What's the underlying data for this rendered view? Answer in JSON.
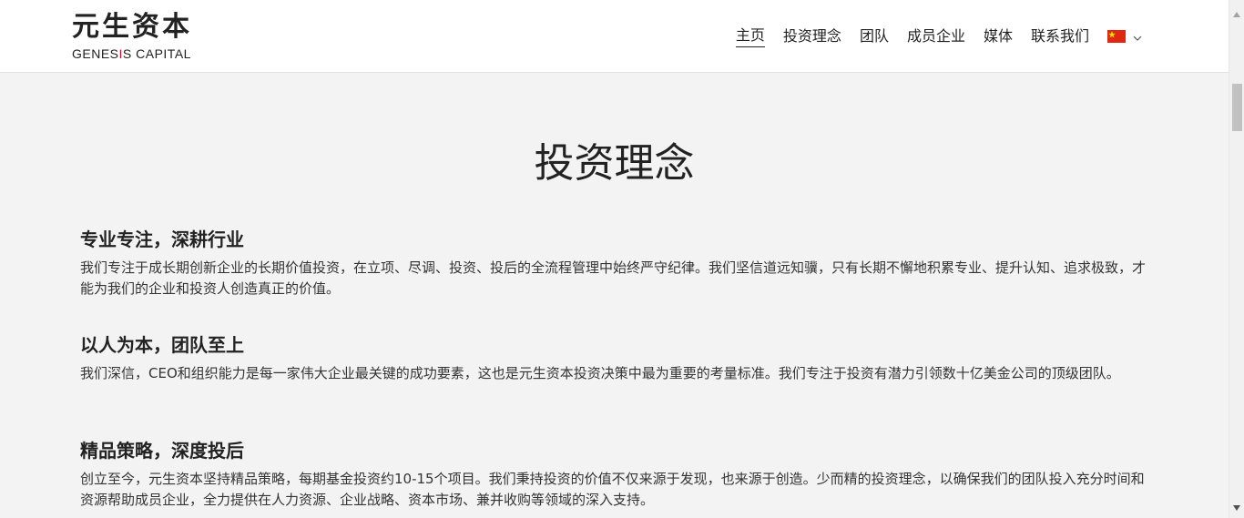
{
  "header": {
    "logo_cn": "元生资本",
    "logo_en_main": "GENES",
    "logo_en_accent": "I",
    "logo_en_rest": "S CAPITAL",
    "nav": [
      {
        "label": "主页",
        "active": true
      },
      {
        "label": "投资理念",
        "active": false
      },
      {
        "label": "团队",
        "active": false
      },
      {
        "label": "成员企业",
        "active": false
      },
      {
        "label": "媒体",
        "active": false
      },
      {
        "label": "联系我们",
        "active": false
      }
    ],
    "language": {
      "flag": "china-flag-icon"
    }
  },
  "main": {
    "title": "投资理念",
    "sections": [
      {
        "heading": "专业专注，深耕行业",
        "body": "我们专注于成长期创新企业的长期价值投资，在立项、尽调、投资、投后的全流程管理中始终严守纪律。我们坚信道远知骥，只有长期不懈地积累专业、提升认知、追求极致，才能为我们的企业和投资人创造真正的价值。"
      },
      {
        "heading": "以人为本，团队至上",
        "body": "我们深信，CEO和组织能力是每一家伟大企业最关键的成功要素，这也是元生资本投资决策中最为重要的考量标准。我们专注于投资有潜力引领数十亿美金公司的顶级团队。"
      },
      {
        "heading": "精品策略，深度投后",
        "body": "创立至今，元生资本坚持精品策略，每期基金投资约10-15个项目。我们秉持投资的价值不仅来源于发现，也来源于创造。少而精的投资理念，以确保我们的团队投入充分时间和资源帮助成员企业，全力提供在人力资源、企业战略、资本市场、兼并收购等领域的深入支持。"
      }
    ]
  },
  "colors": {
    "background": "#f3f3f3",
    "header": "#ffffff",
    "accent": "#c8102e"
  }
}
